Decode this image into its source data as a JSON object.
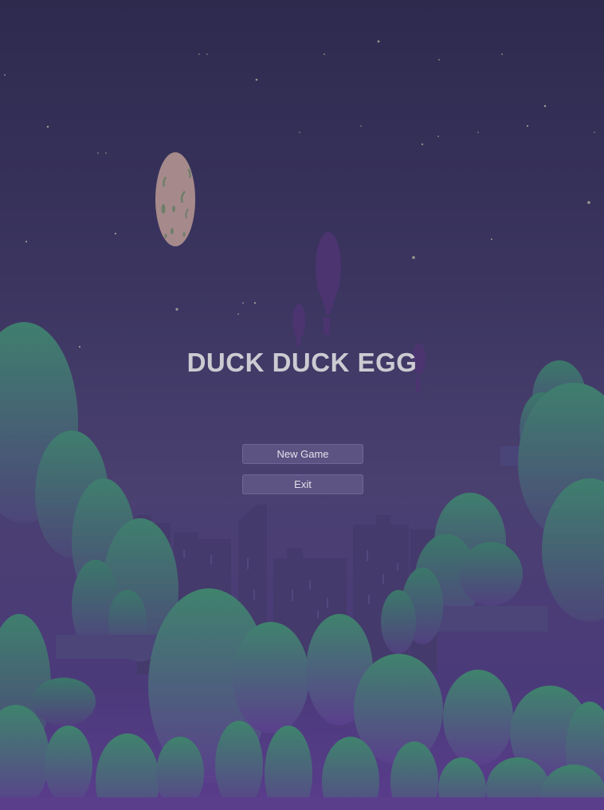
{
  "game": {
    "title": "DUCK DUCK EGG"
  },
  "menu": {
    "new_game_label": "New Game",
    "exit_label": "Exit"
  },
  "palette": {
    "sky_top": "#2e2a4e",
    "sky_bottom": "#5a3d8d",
    "moon": "#a88a8c",
    "tree_green": "#3f7f6e",
    "city": "#443a6b",
    "title_text": "#cdcbd2"
  },
  "icons": {
    "moon": "moon-icon",
    "balloon": "hot-air-balloon-icon"
  }
}
